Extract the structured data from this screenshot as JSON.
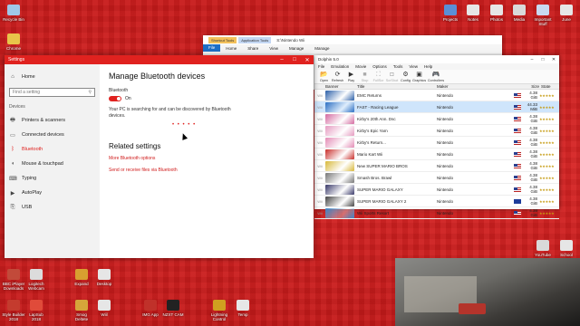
{
  "desktop_icons": [
    {
      "label": "Recycle Bin",
      "color": "#9fc7e8"
    },
    {
      "label": "Chrome",
      "color": "#e8c44a"
    },
    {
      "label": "Projects",
      "color": "#5b8fd6"
    },
    {
      "label": "Notes",
      "color": "#e6e6e6"
    },
    {
      "label": "Photos",
      "color": "#e6e6e6"
    },
    {
      "label": "Media",
      "color": "#d9d9d9"
    },
    {
      "label": "Important Stuff",
      "color": "#c8d9f0"
    },
    {
      "label": "June",
      "color": "#e6e6e6"
    },
    {
      "label": "BBC iPlayer Downloads",
      "color": "#c24a3a"
    },
    {
      "label": "Logitech Webcam",
      "color": "#dcdcdc"
    },
    {
      "label": "Expand",
      "color": "#d8a030"
    },
    {
      "label": "Desktop",
      "color": "#e6e6e6"
    },
    {
      "label": "Style Builder 2018",
      "color": "#c43b2e"
    },
    {
      "label": "LapSub 2018",
      "color": "#e04b3a"
    },
    {
      "label": "Smog Deltete",
      "color": "#d6a63a"
    },
    {
      "label": "Wiil",
      "color": "#e6e6e6"
    },
    {
      "label": "IMG App",
      "color": "#c0312a"
    },
    {
      "label": "NZXT CAM",
      "color": "#222222"
    },
    {
      "label": "Lightning Control",
      "color": "#d0a020"
    },
    {
      "label": "Temp",
      "color": "#e6e6e6"
    },
    {
      "label": "YouTube",
      "color": "#d9d9d9"
    },
    {
      "label": "School",
      "color": "#e6e6e6"
    }
  ],
  "settings": {
    "window_title": "Settings",
    "home_label": "Home",
    "search_placeholder": "Find a setting",
    "section_label": "Devices",
    "sidebar": [
      {
        "label": "Printers & scanners",
        "icon": "printer-icon",
        "glyph": "🖶"
      },
      {
        "label": "Connected devices",
        "icon": "devices-icon",
        "glyph": "▭"
      },
      {
        "label": "Bluetooth",
        "icon": "bluetooth-icon",
        "glyph": "ᛒ"
      },
      {
        "label": "Mouse & touchpad",
        "icon": "mouse-icon",
        "glyph": "◖"
      },
      {
        "label": "Typing",
        "icon": "keyboard-icon",
        "glyph": "⌨"
      },
      {
        "label": "AutoPlay",
        "icon": "autoplay-icon",
        "glyph": "▶"
      },
      {
        "label": "USB",
        "icon": "usb-icon",
        "glyph": "⎘"
      }
    ],
    "page_title": "Manage Bluetooth devices",
    "bluetooth_label": "Bluetooth",
    "toggle_state": "On",
    "description": "Your PC is searching for and can be discovered by Bluetooth devices.",
    "related_title": "Related settings",
    "links": [
      "More Bluetooth options",
      "Send or receive files via Bluetooth"
    ],
    "accent": "#e0221f"
  },
  "explorer": {
    "title": "S:\\Nintendo Wii",
    "tag1": "Shortcut Tools",
    "tag2": "Application Tools",
    "tabs": [
      "File",
      "Home",
      "Share",
      "View",
      "Manage",
      "Manage"
    ]
  },
  "dolphin": {
    "title": "Dolphin 5.0",
    "menu": [
      "File",
      "Emulation",
      "Movie",
      "Options",
      "Tools",
      "View",
      "Help"
    ],
    "toolbar": [
      {
        "label": "Open",
        "glyph": "📂",
        "enabled": true
      },
      {
        "label": "Refresh",
        "glyph": "⟳",
        "enabled": true
      },
      {
        "label": "Play",
        "glyph": "▶",
        "enabled": true
      },
      {
        "label": "Stop",
        "glyph": "■",
        "enabled": false
      },
      {
        "label": "FullScr",
        "glyph": "⛶",
        "enabled": false
      },
      {
        "label": "ScrShot",
        "glyph": "◘",
        "enabled": false
      },
      {
        "label": "Config",
        "glyph": "⚙",
        "enabled": true
      },
      {
        "label": "Graphics",
        "glyph": "▣",
        "enabled": true
      },
      {
        "label": "Controllers",
        "glyph": "🎮",
        "enabled": true
      }
    ],
    "columns": [
      "Banner",
      "Title",
      "Maker",
      "Size",
      "State"
    ],
    "games": [
      {
        "platform": "Wii",
        "title": "EMC Returns",
        "maker": "Nintendo",
        "size": "4.38 GiB",
        "rating": "★★★★★",
        "banner": "#2b5fa8",
        "region": "us"
      },
      {
        "platform": "Wii",
        "title": "FAST - Racing League",
        "maker": "Nintendo",
        "size": "44.33 MiB",
        "rating": "★★★★★",
        "banner": "#2d6fc2",
        "region": "us"
      },
      {
        "platform": "Wii",
        "title": "Kirby's 20th Ann. Dsc",
        "maker": "Nintendo",
        "size": "4.38 GiB",
        "rating": "★★★★★",
        "banner": "#d46aa0",
        "region": "us"
      },
      {
        "platform": "Wii",
        "title": "Kirby's Epic Yarn",
        "maker": "Nintendo",
        "size": "4.38 GiB",
        "rating": "★★★★★",
        "banner": "#e59ac0",
        "region": "us"
      },
      {
        "platform": "Wii",
        "title": "Kirby's Return...",
        "maker": "Nintendo",
        "size": "4.38 GiB",
        "rating": "★★★★★",
        "banner": "#e38bb5",
        "region": "us"
      },
      {
        "platform": "Wii",
        "title": "Mario Kart Wii",
        "maker": "Nintendo",
        "size": "4.38 GiB",
        "rating": "★★★★★",
        "banner": "#c9302c",
        "region": "us"
      },
      {
        "platform": "Wii",
        "title": "New SUPER MARIO BROS",
        "maker": "Nintendo",
        "size": "4.38 GiB",
        "rating": "★★★★★",
        "banner": "#d8b83a",
        "region": "us"
      },
      {
        "platform": "Wii",
        "title": "Smash Bros. Brawl",
        "maker": "Nintendo",
        "size": "4.38 GiB",
        "rating": "★★★★★",
        "banner": "#777777",
        "region": "us"
      },
      {
        "platform": "Wii",
        "title": "SUPER MARIO GALAXY",
        "maker": "Nintendo",
        "size": "4.38 GiB",
        "rating": "★★★★★",
        "banner": "#3a3a6a",
        "region": "us"
      },
      {
        "platform": "Wii",
        "title": "SUPER MARIO GALAXY 2",
        "maker": "Nintendo",
        "size": "4.38 GiB",
        "rating": "★★★★★",
        "banner": "#444444",
        "region": "eu"
      },
      {
        "platform": "Wii",
        "title": "Wii Sports Resort",
        "maker": "Nintendo",
        "size": "4.38 GiB",
        "rating": "★★★★★",
        "banner": "#3e86c8",
        "region": "us"
      }
    ]
  }
}
